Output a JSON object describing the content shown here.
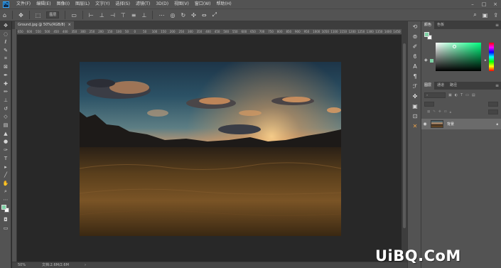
{
  "app": {
    "logo_text": "Ps"
  },
  "menu": {
    "items": [
      "文件(F)",
      "编辑(E)",
      "图像(I)",
      "图层(L)",
      "文字(Y)",
      "选择(S)",
      "滤镜(T)",
      "3D(D)",
      "视图(V)",
      "窗口(W)",
      "帮助(H)"
    ]
  },
  "options_bar": {
    "mode_select": "图层"
  },
  "document": {
    "tab_title": "Ground.jpg @ 50%(RGB/8)",
    "tab_close": "×",
    "zoom": "50%",
    "doc_size": "文档:2.6M/2.6M",
    "ruler_ticks": [
      "650",
      "600",
      "550",
      "500",
      "450",
      "400",
      "350",
      "300",
      "250",
      "200",
      "150",
      "100",
      "50",
      "0",
      "50",
      "100",
      "150",
      "200",
      "250",
      "300",
      "350",
      "400",
      "450",
      "500",
      "550",
      "600",
      "650",
      "700",
      "750",
      "800",
      "850",
      "900",
      "950",
      "1000",
      "1050",
      "1100",
      "1150",
      "1200",
      "1250",
      "1300",
      "1350",
      "1400",
      "1450"
    ]
  },
  "color_panel": {
    "tabs": [
      "颜色",
      "色板"
    ],
    "foreground": "#7fd1a5",
    "background": "#ffffff"
  },
  "layers_panel": {
    "tabs": [
      "图层",
      "通道",
      "路径"
    ],
    "layers": [
      {
        "name": "背景",
        "visible": true,
        "locked": true
      }
    ]
  },
  "watermark": "UiBQ.CoM"
}
